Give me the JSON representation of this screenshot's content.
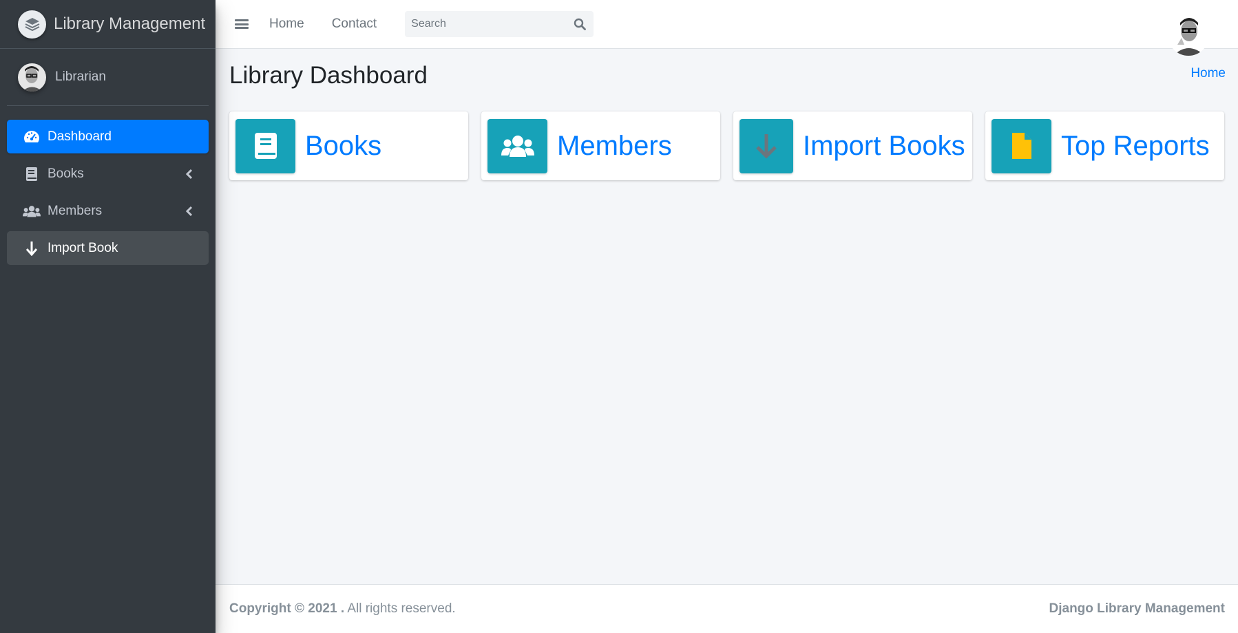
{
  "brand": {
    "title": "Library Management"
  },
  "user": {
    "name": "Librarian"
  },
  "sidebar": {
    "items": [
      {
        "label": "Dashboard",
        "icon": "tachometer-icon"
      },
      {
        "label": "Books",
        "icon": "book-icon"
      },
      {
        "label": "Members",
        "icon": "users-icon"
      },
      {
        "label": "Import Book",
        "icon": "arrow-down-icon"
      }
    ]
  },
  "topbar": {
    "links": [
      "Home",
      "Contact"
    ],
    "search_placeholder": "Search"
  },
  "header": {
    "title": "Library Dashboard",
    "breadcrumb": "Home"
  },
  "boxes": [
    {
      "label": "Books",
      "icon": "book-icon"
    },
    {
      "label": "Members",
      "icon": "users-icon"
    },
    {
      "label": "Import Books",
      "icon": "arrow-down-icon"
    },
    {
      "label": "Top Reports",
      "icon": "file-icon"
    }
  ],
  "footer": {
    "copyright": "Copyright © 2021 .",
    "rights": " All rights reserved.",
    "right_text": "Django Library Management"
  },
  "colors": {
    "sidebar_bg": "#343a40",
    "active": "#007bff",
    "info_icon_bg": "#17a2b8",
    "report_icon": "#ffc107"
  }
}
